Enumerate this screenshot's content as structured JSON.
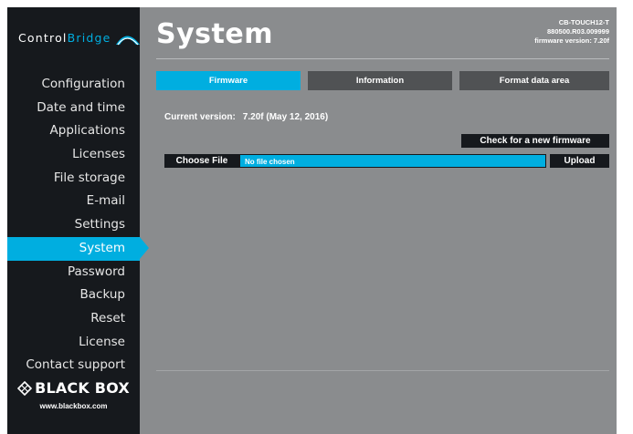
{
  "app": {
    "logo_prefix": "Control",
    "logo_accent": "Bridge",
    "accent_color": "#00aee0",
    "sidebar_color": "#16191d",
    "background_color": "#8a8c8e"
  },
  "sidebar": {
    "items": [
      {
        "label": "Configuration"
      },
      {
        "label": "Date and time"
      },
      {
        "label": "Applications"
      },
      {
        "label": "Licenses"
      },
      {
        "label": "File storage"
      },
      {
        "label": "E-mail"
      },
      {
        "label": "Settings"
      },
      {
        "label": "System"
      },
      {
        "label": "Password"
      },
      {
        "label": "Backup"
      },
      {
        "label": "Reset"
      },
      {
        "label": "License"
      },
      {
        "label": "Contact support"
      }
    ],
    "active_index": 7,
    "brand_name": "BLACK BOX",
    "brand_url": "www.blackbox.com"
  },
  "header": {
    "title": "System",
    "device_model": "CB-TOUCH12-T",
    "device_serial": "880500.R03.009999",
    "firmware_version_line": "firmware version: 7.20f"
  },
  "tabs": [
    {
      "label": "Firmware",
      "active": true
    },
    {
      "label": "Information",
      "active": false
    },
    {
      "label": "Format data area",
      "active": false
    }
  ],
  "firmware": {
    "current_version_label": "Current version:",
    "current_version_value": "7.20f (May 12, 2016)",
    "check_button": "Check for a new firmware",
    "choose_file_button": "Choose File",
    "file_status": "No file chosen",
    "upload_button": "Upload"
  }
}
